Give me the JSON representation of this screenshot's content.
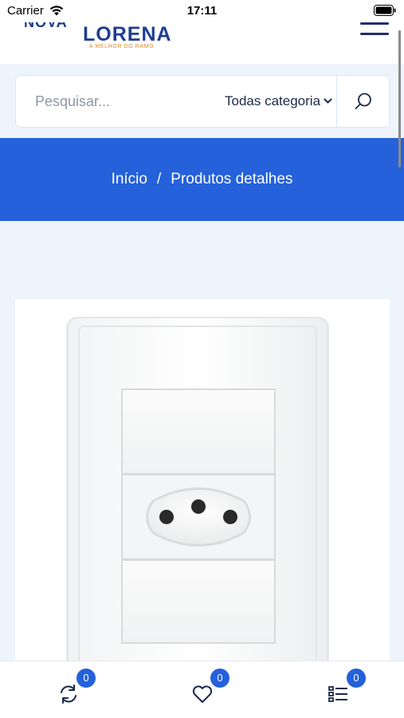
{
  "status_bar": {
    "carrier": "Carrier",
    "time": "17:11"
  },
  "header": {
    "logo": {
      "name": "LORENA",
      "tagline": "A MELHOR DO RAMO"
    },
    "menu_icon": "hamburger-icon"
  },
  "search": {
    "placeholder": "Pesquisar...",
    "category": "Todas categoria",
    "button_icon": "search-icon"
  },
  "breadcrumb": {
    "home": "Início",
    "separator": "/",
    "current": "Produtos detalhes"
  },
  "product": {
    "image_icon": "wall-outlet-image"
  },
  "bottom_bar": {
    "items": [
      {
        "icon": "compare-icon",
        "badge": "0"
      },
      {
        "icon": "heart-icon",
        "badge": "0"
      },
      {
        "icon": "list-icon",
        "badge": "0"
      }
    ]
  },
  "colors": {
    "brand_blue": "#2461db",
    "logo_navy": "#1f3d91",
    "tagline_orange": "#e08a2a",
    "page_background": "#eef4fc"
  }
}
